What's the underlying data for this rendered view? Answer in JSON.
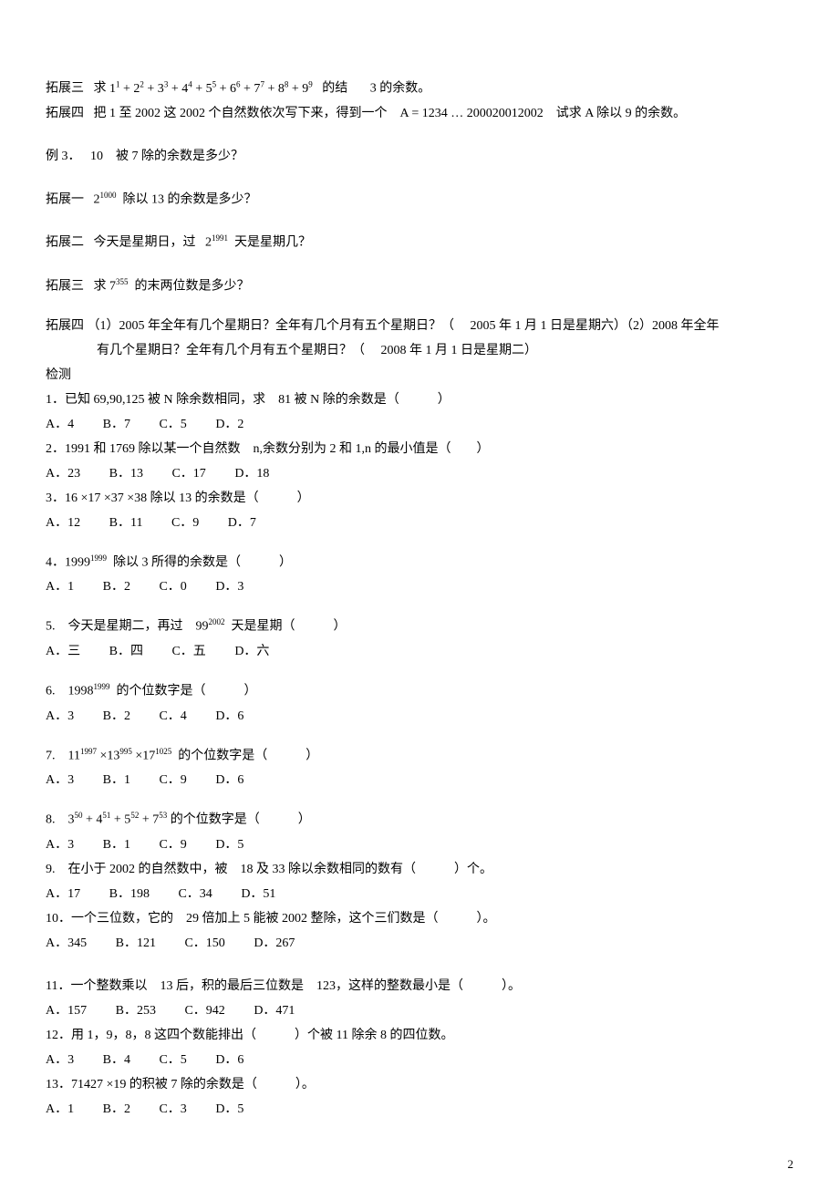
{
  "tuozhan3": {
    "label": "拓展三",
    "pre": "求",
    "expr": "1<sup>1</sup> + 2<sup>2</sup> + 3<sup>3</sup> + 4<sup>4</sup> + 5<sup>5</sup> + 6<sup>6</sup> + 7<sup>7</sup> + 8<sup>8</sup> + 9<sup>9</sup>",
    "mid": "的结",
    "tail": "3 的余数。"
  },
  "tuozhan4": {
    "label": "拓展四",
    "t1": "把 1 至 2002 这 2002 个自然数依次写下来，得到一个",
    "t2": "A = 1234 … 200020012002",
    "t3": "试求 A 除以 9 的余数。"
  },
  "li3": {
    "label": "例 3．",
    "t": "10　被 7 除的余数是多少？"
  },
  "tz1": {
    "label": "拓展一",
    "pre": "2",
    "exp": "1000",
    "t": "除以 13 的余数是多少？"
  },
  "tz2": {
    "label": "拓展二",
    "t1": "今天是星期日，过",
    "pre": "2",
    "exp": "1991",
    "t2": "天是星期几？"
  },
  "tz3b": {
    "label": "拓展三",
    "pre": "求 7",
    "exp": "355",
    "t": "的末两位数是多少？"
  },
  "tz4b": {
    "label": "拓展四",
    "l1a": "（1）2005 年全年有几个星期日？全年有几个月有五个星期日？（",
    "l1b": "2005 年 1 月 1 日是星期六）（2）2008 年全年",
    "l2": "有几个星期日？全年有几个月有五个星期日？（",
    "l2b": "2008 年 1 月 1 日是星期二）"
  },
  "jiance": "检测",
  "q1": {
    "t": "1．已知 69,90,125 被 N 除余数相同，求　81 被 N 除的余数是（　　　）",
    "a": "A．4",
    "b": "B．7",
    "c": "C．5",
    "d": "D．2"
  },
  "q2": {
    "t": "2．1991 和 1769 除以某一个自然数　n,余数分别为 2 和 1,n 的最小值是（　　）",
    "a": "A．23",
    "b": "B．13",
    "c": "C．17",
    "d": "D．18"
  },
  "q3": {
    "t": "3．16 ×17 ×37 ×38 除以 13 的余数是（　　　）",
    "a": "A．12",
    "b": "B．11",
    "c": "C．9",
    "d": "D．7"
  },
  "q4": {
    "pre": "4．1999",
    "exp": "1999",
    "post": "除以 3 所得的余数是（　　　）",
    "a": "A．1",
    "b": "B．2",
    "c": "C．0",
    "d": "D．3"
  },
  "q5": {
    "pre": "5.　今天是星期二，再过　99",
    "exp": "2002",
    "post": "天是星期（　　　）",
    "a": "A．三",
    "b": "B．四",
    "c": "C．五",
    "d": "D．六"
  },
  "q6": {
    "pre": "6.　1998",
    "exp": "1999",
    "post": "的个位数字是（　　　）",
    "a": "A．3",
    "b": "B．2",
    "c": "C．4",
    "d": "D．6"
  },
  "q7": {
    "pre": "7.　11",
    "e1": "1997",
    "m1": " ×13",
    "e2": "995",
    "m2": " ×17",
    "e3": "1025",
    "post": "的个位数字是（　　　）",
    "a": "A．3",
    "b": "B．1",
    "c": "C．9",
    "d": "D．6"
  },
  "q8": {
    "pre": "8.　3",
    "e1": "50",
    "m1": " + 4",
    "e2": "51",
    "m2": " + 5",
    "e3": "52",
    "m3": " + 7",
    "e4": "53",
    "post": "的个位数字是（　　　）",
    "a": "A．3",
    "b": "B．1",
    "c": "C．9",
    "d": "D．5"
  },
  "q9": {
    "t": "9.　在小于 2002 的自然数中，被　18 及 33 除以余数相同的数有（　　　）个。",
    "a": "A．17",
    "b": "B．198",
    "c": "C．34",
    "d": "D．51"
  },
  "q10": {
    "t": "10．一个三位数，它的　29 倍加上 5 能被 2002 整除，这个三们数是（　　　）。",
    "a": "A．345",
    "b": "B．121",
    "c": "C．150",
    "d": "D．267"
  },
  "q11": {
    "t": "11．一个整数乘以　13 后，积的最后三位数是　123，这样的整数最小是（　　　）。",
    "a": "A．157",
    "b": "B．253",
    "c": "C．942",
    "d": "D．471"
  },
  "q12": {
    "t": "12．用 1，9，8，8 这四个数能排出（　　　）个被 11 除余 8 的四位数。",
    "a": "A．3",
    "b": "B．4",
    "c": "C．5",
    "d": "D．6"
  },
  "q13": {
    "t": "13．71427 ×19 的积被 7 除的余数是（　　　）。",
    "a": "A．1",
    "b": "B．2",
    "c": "C．3",
    "d": "D．5"
  },
  "pagenum": "2"
}
